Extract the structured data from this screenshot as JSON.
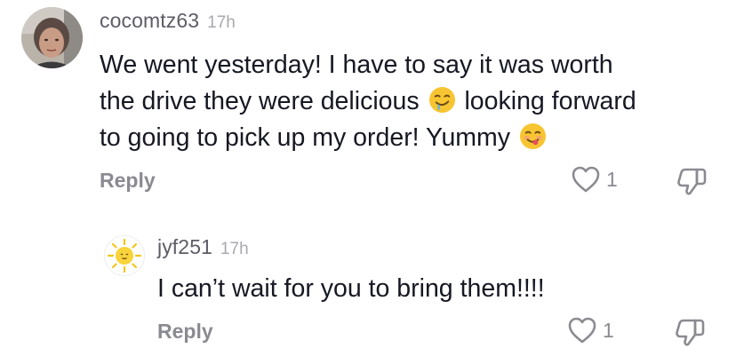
{
  "comments": [
    {
      "username": "cocomtz63",
      "time": "17h",
      "text_lines": [
        "We went yesterday! I have to say it was worth",
        "the drive they were delicious",
        "looking forward",
        "to going to pick up my order! Yummy"
      ],
      "emojis": [
        "drooling-face-emoji",
        "savoring-food-emoji"
      ],
      "reply_label": "Reply",
      "like_count": "1"
    },
    {
      "username": "jyf251",
      "time": "17h",
      "text": "I can’t wait for you to bring them!!!!",
      "reply_label": "Reply",
      "like_count": "1"
    }
  ],
  "colors": {
    "text": "#161823",
    "username": "#5c5d66",
    "muted": "#8a8b91",
    "time": "#a8a9ae"
  }
}
